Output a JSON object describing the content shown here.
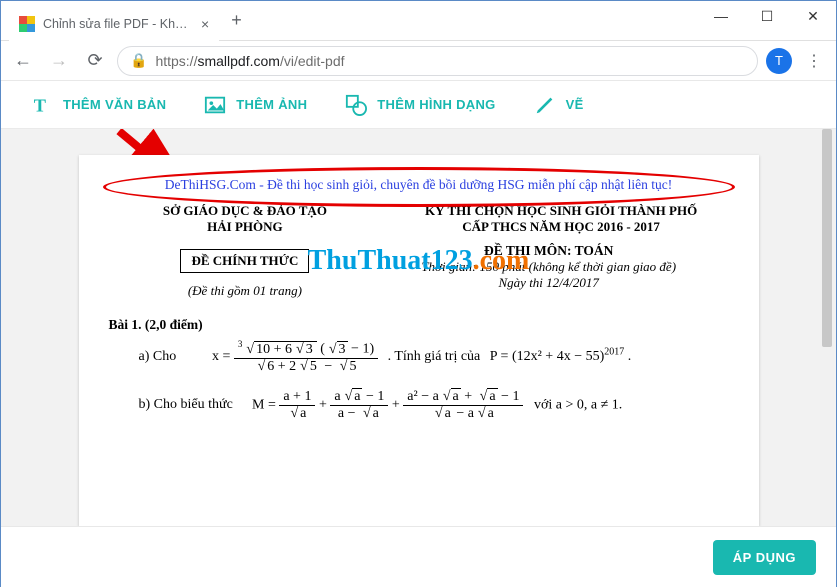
{
  "browser": {
    "tab_title": "Chỉnh sửa file PDF - Không ảnh h",
    "url_scheme": "https://",
    "url_host": "smallpdf.com",
    "url_path": "/vi/edit-pdf",
    "avatar_letter": "T"
  },
  "toolbar": {
    "text": "THÊM VĂN BẢN",
    "image": "THÊM ẢNH",
    "shape": "THÊM HÌNH DẠNG",
    "draw": "VẼ"
  },
  "doc": {
    "link": "DeThiHSG.Com - Đề thi học sinh giỏi, chuyên đề bồi dưỡng HSG miễn phí cập nhật liên tục!",
    "left_org1": "SỞ GIÁO DỤC & ĐÀO TẠO",
    "left_org2": "HẢI PHÒNG",
    "right_title1": "KỲ THI CHỌN HỌC SINH GIỎI THÀNH PHỐ",
    "right_title2": "CẤP THCS NĂM HỌC 2016 - 2017",
    "boxed": "ĐỀ CHÍNH THỨC",
    "subject": "ĐỀ THI MÔN: TOÁN",
    "duration": "Thời gian: 150 phút (không kể thời gian giao đề)",
    "date": "Ngày thi 12/4/2017",
    "pages": "(Đề thi gồm 01 trang)",
    "bai1_title": "Bài 1. (2,0 điểm)",
    "a_label": "a) Cho",
    "a_tail": ".  Tính giá trị của",
    "b_label": "b) Cho biểu thức",
    "b_tail": "với a > 0, a ≠ 1.",
    "watermark_a": "ThuThuat123",
    "watermark_b": ".com"
  },
  "footer": {
    "apply": "ÁP DỤNG"
  }
}
